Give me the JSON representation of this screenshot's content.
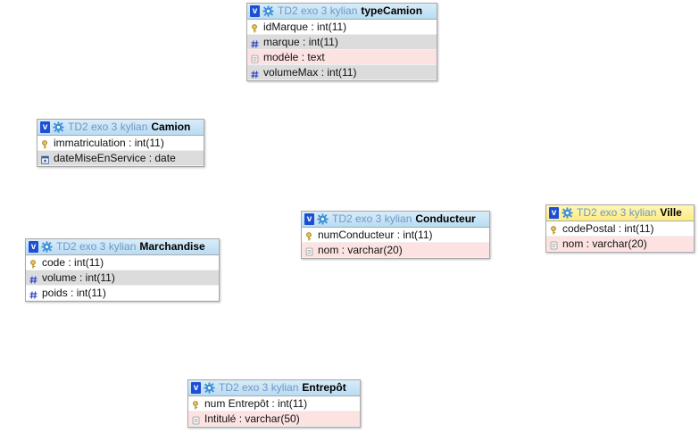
{
  "tables": [
    {
      "id": "typeCamion",
      "db": "TD2 exo 3 kylian",
      "name": "typeCamion",
      "yellow": false,
      "fields": [
        {
          "text": "idMarque : int(11)",
          "icon": "key-icon",
          "bg": "white"
        },
        {
          "text": "marque : int(11)",
          "icon": "hash-icon",
          "bg": "grey"
        },
        {
          "text": "modèle : text",
          "icon": "text-icon",
          "bg": "pink"
        },
        {
          "text": "volumeMax : int(11)",
          "icon": "hash-icon",
          "bg": "grey"
        }
      ]
    },
    {
      "id": "Camion",
      "db": "TD2 exo 3 kylian",
      "name": "Camion",
      "yellow": false,
      "fields": [
        {
          "text": "immatriculation : int(11)",
          "icon": "key-icon",
          "bg": "white"
        },
        {
          "text": "dateMiseEnService : date",
          "icon": "date-icon",
          "bg": "grey"
        }
      ]
    },
    {
      "id": "Conducteur",
      "db": "TD2 exo 3 kylian",
      "name": "Conducteur",
      "yellow": false,
      "fields": [
        {
          "text": "numConducteur : int(11)",
          "icon": "key-icon",
          "bg": "white"
        },
        {
          "text": "nom : varchar(20)",
          "icon": "text-icon",
          "bg": "pink"
        }
      ]
    },
    {
      "id": "Ville",
      "db": "TD2 exo 3 kylian",
      "name": "Ville",
      "yellow": true,
      "fields": [
        {
          "text": "codePostal : int(11)",
          "icon": "key-icon",
          "bg": "white"
        },
        {
          "text": "nom : varchar(20)",
          "icon": "text-icon",
          "bg": "pink"
        }
      ]
    },
    {
      "id": "Marchandise",
      "db": "TD2 exo 3 kylian",
      "name": "Marchandise",
      "yellow": false,
      "fields": [
        {
          "text": "code : int(11)",
          "icon": "key-icon",
          "bg": "white"
        },
        {
          "text": "volume : int(11)",
          "icon": "hash-icon",
          "bg": "grey"
        },
        {
          "text": "poids : int(11)",
          "icon": "hash-icon",
          "bg": "white"
        }
      ]
    },
    {
      "id": "Entrepot",
      "db": "TD2 exo 3 kylian",
      "name": "Entrepôt",
      "yellow": false,
      "fields": [
        {
          "text": "num Entrepôt : int(11)",
          "icon": "key-icon",
          "bg": "white"
        },
        {
          "text": "Intitulé : varchar(50)",
          "icon": "text-icon",
          "bg": "pink"
        }
      ]
    }
  ],
  "colors": {
    "header_blue": "#b9dcf3",
    "header_yellow": "#ffec80",
    "row_grey": "#dcdcdc",
    "row_pink": "#fde2e2",
    "db_text": "#6f97c6",
    "toggle": "#1d4fd6"
  }
}
